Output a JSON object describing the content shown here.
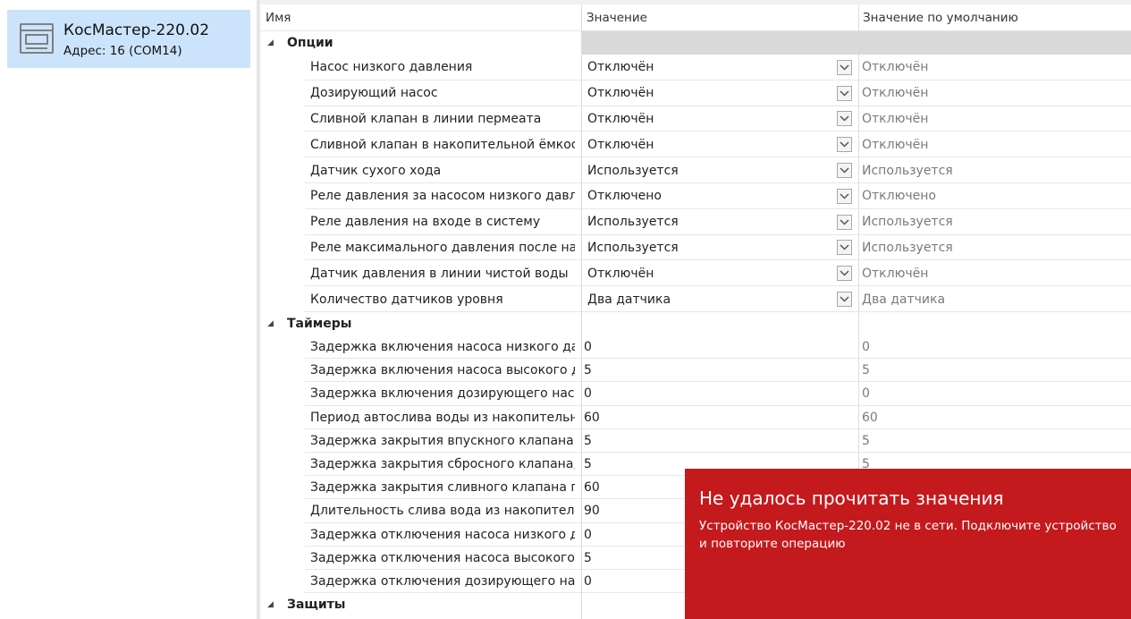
{
  "device": {
    "name": "КосМастер-220.02",
    "address": "Адрес: 16 (COM14)",
    "icon": "device-panel-icon"
  },
  "grid": {
    "columns": {
      "name": "Имя",
      "value": "Значение",
      "default": "Значение по умолчанию"
    },
    "groups": [
      {
        "title": "Опции",
        "rows": [
          {
            "name": "Насос низкого давления",
            "value": "Отключён",
            "default": "Отключён",
            "dropdown": true
          },
          {
            "name": "Дозирующий насос",
            "value": "Отключён",
            "default": "Отключён",
            "dropdown": true
          },
          {
            "name": "Сливной клапан в линии пермеата",
            "value": "Отключён",
            "default": "Отключён",
            "dropdown": true
          },
          {
            "name": "Сливной клапан в накопительной ёмкости",
            "value": "Отключён",
            "default": "Отключён",
            "dropdown": true
          },
          {
            "name": "Датчик сухого хода",
            "value": "Используется",
            "default": "Используется",
            "dropdown": true
          },
          {
            "name": "Реле давления за насосом низкого давле...",
            "value": "Отключено",
            "default": "Отключено",
            "dropdown": true
          },
          {
            "name": "Реле давления на входе в систему",
            "value": "Используется",
            "default": "Используется",
            "dropdown": true
          },
          {
            "name": "Реле максимального давления после нас...",
            "value": "Используется",
            "default": "Используется",
            "dropdown": true
          },
          {
            "name": "Датчик давления в линии чистой воды",
            "value": "Отключён",
            "default": "Отключён",
            "dropdown": true
          },
          {
            "name": "Количество датчиков уровня",
            "value": "Два датчика",
            "default": "Два датчика",
            "dropdown": true
          }
        ]
      },
      {
        "title": "Таймеры",
        "rows": [
          {
            "name": "Задержка включения насоса низкого дав...",
            "value": "0",
            "default": "0",
            "dropdown": false
          },
          {
            "name": "Задержка включения насоса высокого д...",
            "value": "5",
            "default": "5",
            "dropdown": false
          },
          {
            "name": "Задержка включения дозирующего насо...",
            "value": "0",
            "default": "0",
            "dropdown": false
          },
          {
            "name": "Период автослива воды из накопительн...",
            "value": "60",
            "default": "60",
            "dropdown": false
          },
          {
            "name": "Задержка закрытия впускного клапана, с",
            "value": "5",
            "default": "5",
            "dropdown": false
          },
          {
            "name": "Задержка закрытия сбросного клапана, с",
            "value": "5",
            "default": "5",
            "dropdown": false
          },
          {
            "name": "Задержка закрытия сливного клапана пр...",
            "value": "60",
            "default": "",
            "dropdown": false
          },
          {
            "name": "Длительность слива вода из накопитель...",
            "value": "90",
            "default": "",
            "dropdown": false
          },
          {
            "name": "Задержка отключения насоса низкого да...",
            "value": "0",
            "default": "",
            "dropdown": false
          },
          {
            "name": "Задержка отключения насоса высокого...",
            "value": "5",
            "default": "",
            "dropdown": false
          },
          {
            "name": "Задержка отключения дозирующего нас...",
            "value": "0",
            "default": "",
            "dropdown": false
          }
        ]
      },
      {
        "title": "Защиты",
        "rows": []
      }
    ]
  },
  "toast": {
    "title": "Не удалось прочитать значения",
    "message": "Устройство КосМастер-220.02  не в сети. Подключите устройство и повторите операцию",
    "background": "#c4191d"
  },
  "colors": {
    "selection": "#cce4fb",
    "group_fill": "#d9d9d9",
    "default_text": "#7a7a7a"
  }
}
